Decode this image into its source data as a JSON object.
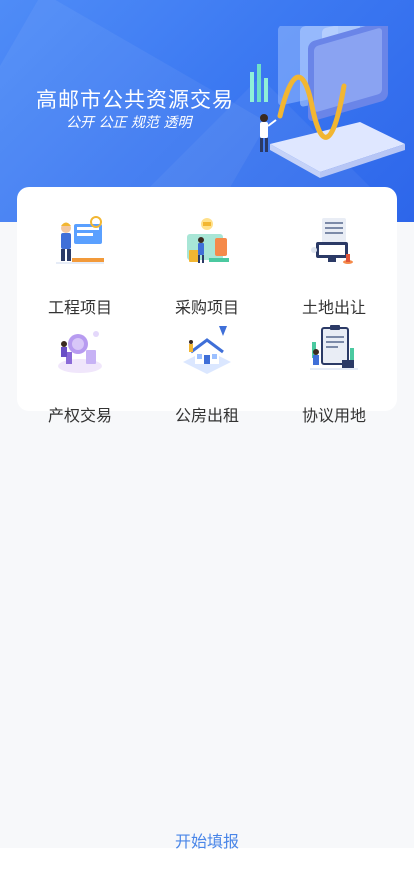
{
  "banner": {
    "title": "高邮市公共资源交易",
    "subtitle": "公开 公正 规范 透明"
  },
  "categories": [
    {
      "label": "工程项目",
      "icon": "construction-worker-icon"
    },
    {
      "label": "采购项目",
      "icon": "procurement-icon"
    },
    {
      "label": "土地出让",
      "icon": "land-transfer-icon"
    },
    {
      "label": "产权交易",
      "icon": "property-rights-icon"
    },
    {
      "label": "公房出租",
      "icon": "public-housing-rental-icon"
    },
    {
      "label": "协议用地",
      "icon": "agreement-land-icon"
    }
  ],
  "footer": {
    "start_label": "开始填报"
  },
  "colors": {
    "banner_blue": "#3d7af2",
    "link_blue": "#4a86e8",
    "text_dark": "#333333",
    "page_bg": "#f7f8fa"
  }
}
